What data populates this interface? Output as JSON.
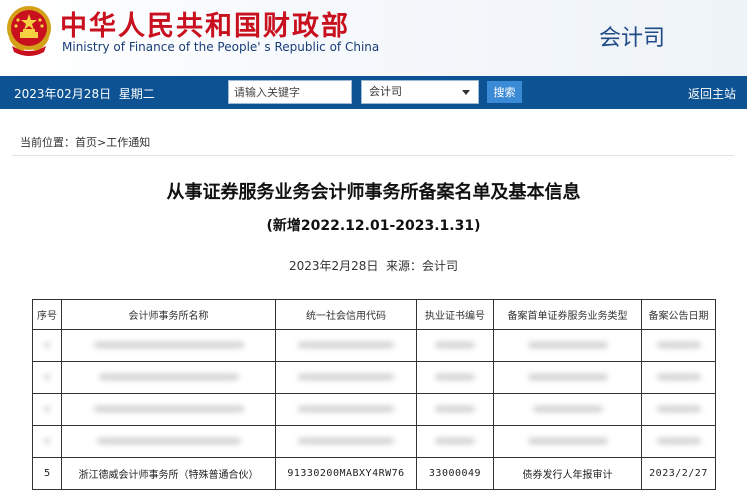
{
  "header": {
    "title_cn": "中华人民共和国财政部",
    "title_en": "Ministry of Finance of the People' s Republic of China",
    "department": "会计司",
    "emblem_icon": "national-emblem-icon",
    "brand_red": "#c8101e",
    "brand_blue": "#0d5293"
  },
  "navbar": {
    "date": "2023年02月28日",
    "weekday": "星期二",
    "search_placeholder": "请输入关键字",
    "scope_select": "会计司",
    "search_button": "搜索",
    "back_link": "返回主站"
  },
  "breadcrumb": {
    "prefix": "当前位置：",
    "home": "首页",
    "separator": ">",
    "current": "工作通知"
  },
  "article": {
    "title": "从事证券服务业务会计师事务所备案名单及基本信息",
    "subtitle": "(新增2022.12.01-2023.1.31)",
    "date": "2023年2月28日",
    "source_label": "来源：",
    "source": "会计司"
  },
  "table": {
    "headers": [
      "序号",
      "会计师事务所名称",
      "统一社会信用代码",
      "执业证书编号",
      "备案首单证券服务业务类型",
      "备案公告日期"
    ],
    "last_row": [
      "5",
      "浙江德威会计师事务所（特殊普通合伙）",
      "91330200MABXY4RW76",
      "33000049",
      "债券发行人年报审计",
      "2023/2/27"
    ]
  }
}
